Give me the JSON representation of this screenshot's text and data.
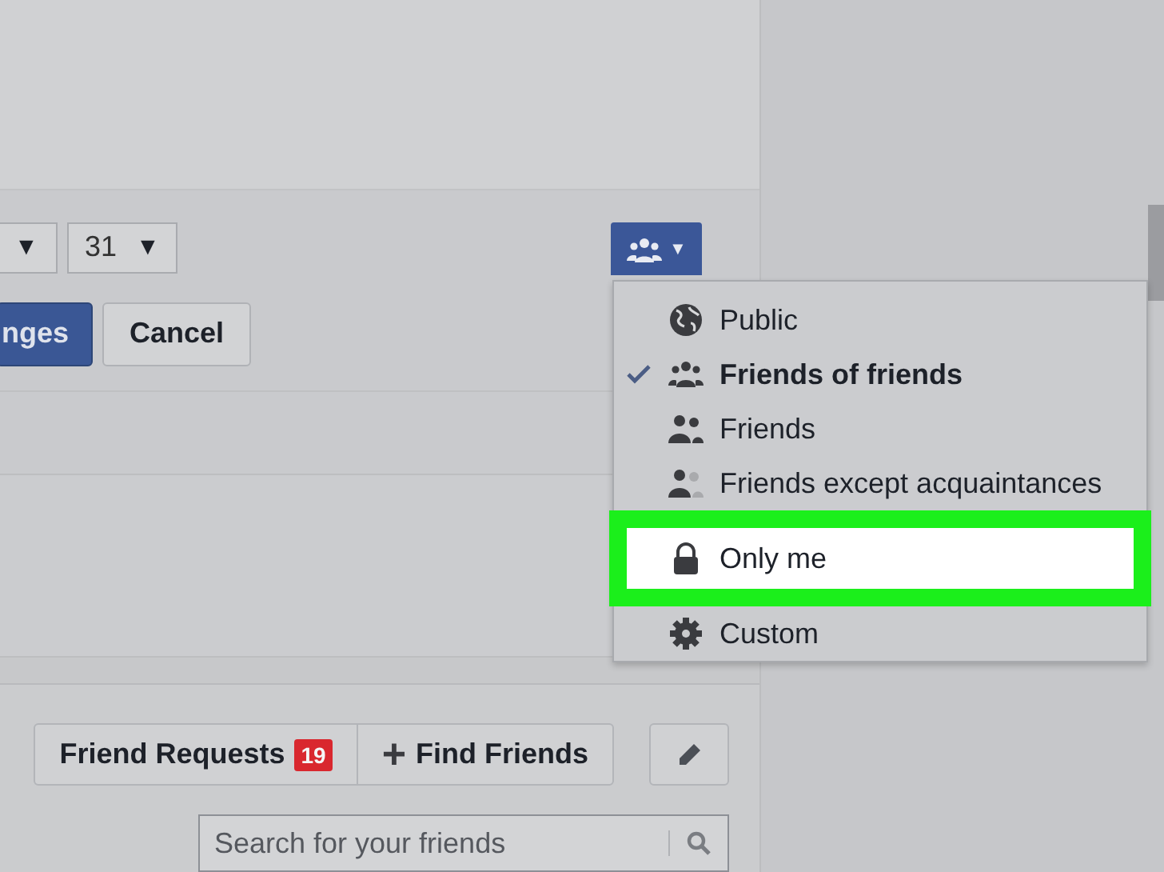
{
  "date_selects": [
    {
      "caret": "▼"
    },
    {
      "value": "31",
      "caret": "▼"
    }
  ],
  "audience_button": {
    "caret": "▼"
  },
  "buttons": [
    {
      "label": "nges",
      "kind": "primary"
    },
    {
      "label": "Cancel",
      "kind": "default"
    }
  ],
  "audience_menu": [
    {
      "label": "Public",
      "kind": "globe",
      "selected": false,
      "highlighted": false
    },
    {
      "label": "Friends of friends",
      "kind": "group",
      "selected": true,
      "highlighted": false
    },
    {
      "label": "Friends",
      "kind": "pair",
      "selected": false,
      "highlighted": false
    },
    {
      "label": "Friends except acquaintances",
      "kind": "pair-faded",
      "selected": false,
      "highlighted": false
    },
    {
      "label": "Only me",
      "kind": "lock",
      "selected": false,
      "highlighted": true
    },
    {
      "label": "Custom",
      "kind": "gear",
      "selected": false,
      "highlighted": false
    }
  ],
  "friends_bar": {
    "requests_label": "Friend Requests",
    "requests_count": "19",
    "find_label": "Find Friends",
    "find_icon": "+"
  },
  "search": {
    "placeholder": "Search for your friends"
  }
}
